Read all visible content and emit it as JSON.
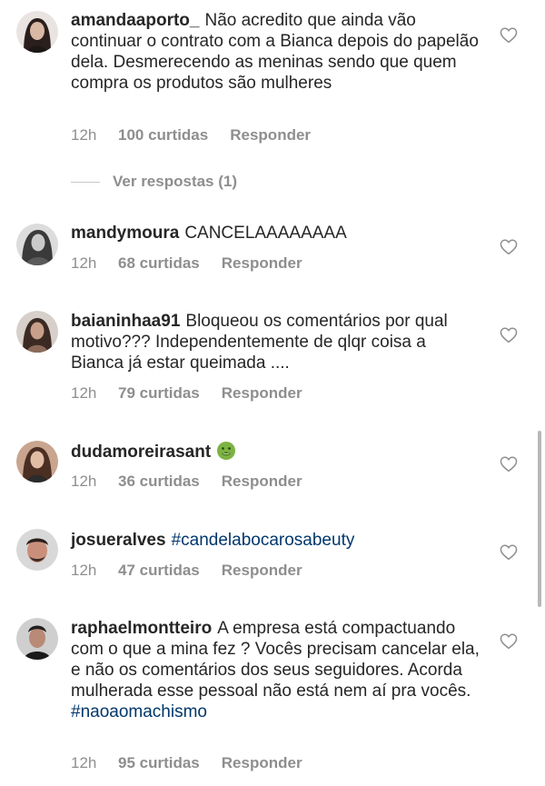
{
  "comments": [
    {
      "username": "amandaaporto_",
      "text": "Não acredito que ainda vão continuar o contrato com a Bianca depois do papelão dela. Desmerecendo as meninas sendo que quem compra os produtos são mulheres",
      "time": "12h",
      "likes": "100 curtidas",
      "reply": "Responder"
    },
    {
      "username": "mandymoura",
      "text": "CANCELAAAAAAAA",
      "time": "12h",
      "likes": "68 curtidas",
      "reply": "Responder"
    },
    {
      "username": "baianinhaa91",
      "text": "Bloqueou os comentários por qual motivo??? Independentemente de qlqr coisa a Bianca já estar queimada ....",
      "time": "12h",
      "likes": "79 curtidas",
      "reply": "Responder"
    },
    {
      "username": "dudamoreirasant",
      "text": "",
      "emoji": "nauseated-face-emoji",
      "time": "12h",
      "likes": "36 curtidas",
      "reply": "Responder"
    },
    {
      "username": "josueralves",
      "hashtag": "#candelabocarosabeuty",
      "time": "12h",
      "likes": "47 curtidas",
      "reply": "Responder"
    },
    {
      "username": "raphaelmontteiro",
      "text": "A empresa está compactuando com o que a mina fez ? Vocês precisam cancelar ela, e não os comentários dos seus seguidores. Acorda mulherada esse pessoal não está nem aí pra vocês.",
      "hashtag": "#naoaomachismo",
      "time": "12h",
      "likes": "95 curtidas",
      "reply": "Responder"
    }
  ],
  "view_replies": "Ver respostas (1)",
  "icons": {
    "like": "heart-outline-icon"
  },
  "colors": {
    "text": "#262626",
    "muted": "#8e8e8e",
    "hashtag": "#00376b"
  }
}
